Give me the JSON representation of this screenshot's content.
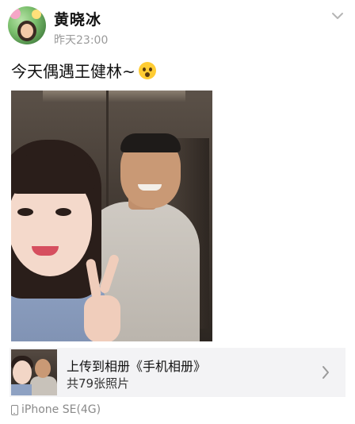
{
  "header": {
    "username": "黄晓冰",
    "timestamp": "昨天23:00",
    "menu_icon": "chevron-down-icon"
  },
  "post": {
    "caption_text": "今天偶遇王健林~",
    "caption_emoji": "surprised-face-emoji"
  },
  "album_link": {
    "title": "上传到相册《手机相册》",
    "subtitle": "共79张照片",
    "arrow_icon": "chevron-right-icon"
  },
  "device": {
    "icon": "phone-icon",
    "label": "iPhone SE(4G)"
  }
}
